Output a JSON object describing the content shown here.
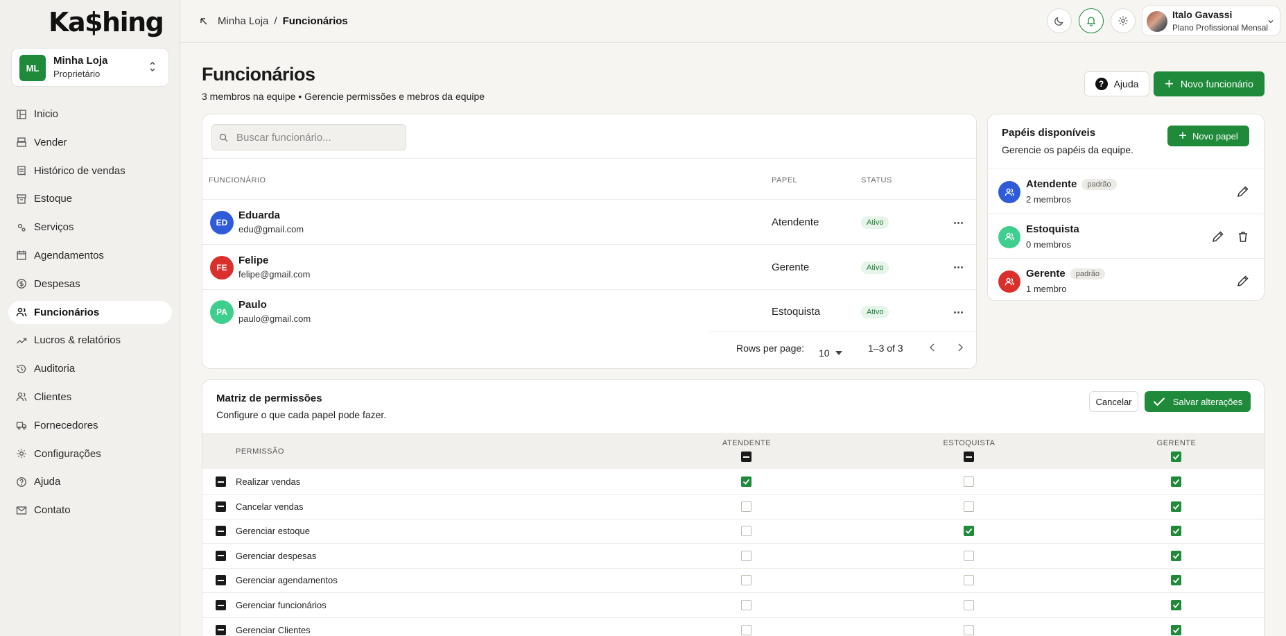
{
  "brand": {
    "logo": "Ka$hing",
    "accent": "#1e8a3a"
  },
  "store": {
    "initials": "ML",
    "name": "Minha Loja",
    "role": "Proprietário"
  },
  "sidebar": {
    "items": [
      {
        "label": "Inicio",
        "icon": "layout-icon"
      },
      {
        "label": "Vender",
        "icon": "register-icon"
      },
      {
        "label": "Histórico de vendas",
        "icon": "receipt-icon"
      },
      {
        "label": "Estoque",
        "icon": "archive-icon"
      },
      {
        "label": "Serviços",
        "icon": "cogs-icon"
      },
      {
        "label": "Agendamentos",
        "icon": "calendar-icon"
      },
      {
        "label": "Despesas",
        "icon": "dollar-icon"
      },
      {
        "label": "Funcionários",
        "icon": "users-icon",
        "active": true
      },
      {
        "label": "Lucros & relatórios",
        "icon": "trend-icon"
      },
      {
        "label": "Auditoria",
        "icon": "history-icon"
      },
      {
        "label": "Clientes",
        "icon": "clients-icon"
      },
      {
        "label": "Fornecedores",
        "icon": "truck-icon"
      },
      {
        "label": "Configurações",
        "icon": "gear-icon"
      },
      {
        "label": "Ajuda",
        "icon": "help-icon"
      },
      {
        "label": "Contato",
        "icon": "mail-icon"
      }
    ]
  },
  "header": {
    "breadcrumb": {
      "parent": "Minha Loja",
      "separator": "/",
      "current": "Funcionários"
    },
    "user": {
      "name": "Italo Gavassi",
      "plan": "Plano Profissional Mensal"
    }
  },
  "page": {
    "title": "Funcionários",
    "subtitle": "3 membros na equipe • Gerencie permissões e mebros da equipe",
    "help_label": "Ajuda",
    "new_label": "Novo funcionário"
  },
  "employees": {
    "search_placeholder": "Buscar funcionário...",
    "columns": {
      "employee": "FUNCIONÁRIO",
      "role": "PAPEL",
      "status": "STATUS"
    },
    "rows": [
      {
        "initials": "ED",
        "name": "Eduarda",
        "email": "edu@gmail.com",
        "role": "Atendente",
        "status": "Ativo",
        "color": "#2f5bd8"
      },
      {
        "initials": "FE",
        "name": "Felipe",
        "email": "felipe@gmail.com",
        "role": "Gerente",
        "status": "Ativo",
        "color": "#d9302c"
      },
      {
        "initials": "PA",
        "name": "Paulo",
        "email": "paulo@gmail.com",
        "role": "Estoquista",
        "status": "Ativo",
        "color": "#3ecf8e"
      }
    ],
    "pagination": {
      "rows_label": "Rows per page:",
      "rows_value": "10",
      "range": "1–3 of 3"
    }
  },
  "roles": {
    "title": "Papéis disponíveis",
    "subtitle": "Gerencie os papéis da equipe.",
    "new_label": "Novo papel",
    "items": [
      {
        "name": "Atendente",
        "tag": "padrão",
        "count": "2 membros",
        "color": "#2f5bd8",
        "deletable": false
      },
      {
        "name": "Estoquista",
        "tag": "",
        "count": "0 membros",
        "color": "#3ecf8e",
        "deletable": true
      },
      {
        "name": "Gerente",
        "tag": "padrão",
        "count": "1 membro",
        "color": "#d9302c",
        "deletable": false
      }
    ]
  },
  "permissions": {
    "title": "Matriz de permissões",
    "subtitle": "Configure o que cada papel pode fazer.",
    "cancel_label": "Cancelar",
    "save_label": "Salvar alterações",
    "column_label": "PERMISSÃO",
    "roles": [
      {
        "name": "ATENDENTE",
        "header_state": "indeterminate"
      },
      {
        "name": "ESTOQUISTA",
        "header_state": "indeterminate"
      },
      {
        "name": "GERENTE",
        "header_state": "checked"
      }
    ],
    "rows": [
      {
        "label": "Realizar vendas",
        "values": [
          true,
          false,
          true
        ]
      },
      {
        "label": "Cancelar vendas",
        "values": [
          false,
          false,
          true
        ]
      },
      {
        "label": "Gerenciar estoque",
        "values": [
          false,
          true,
          true
        ]
      },
      {
        "label": "Gerenciar despesas",
        "values": [
          false,
          false,
          true
        ]
      },
      {
        "label": "Gerenciar agendamentos",
        "values": [
          false,
          false,
          true
        ]
      },
      {
        "label": "Gerenciar funcionários",
        "values": [
          false,
          false,
          true
        ]
      },
      {
        "label": "Gerenciar Clientes",
        "values": [
          false,
          false,
          true
        ]
      }
    ]
  }
}
